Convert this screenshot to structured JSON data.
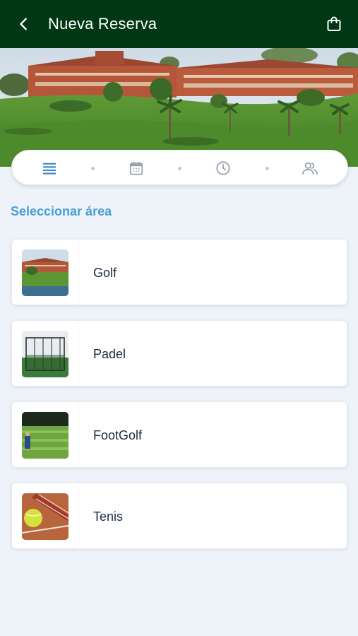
{
  "header": {
    "title": "Nueva Reserva",
    "back_icon": "chevron-left-icon",
    "cart_icon": "shopping-bag-icon",
    "background": "#003714"
  },
  "stepper": {
    "steps": [
      {
        "icon": "list-icon",
        "active": true
      },
      {
        "icon": "calendar-icon",
        "active": false
      },
      {
        "icon": "clock-icon",
        "active": false
      },
      {
        "icon": "users-icon",
        "active": false
      }
    ],
    "active_color": "#3d8bc9",
    "inactive_color": "#9aa3ae"
  },
  "section": {
    "title": "Seleccionar área"
  },
  "areas": [
    {
      "label": "Golf"
    },
    {
      "label": "Padel"
    },
    {
      "label": "FootGolf"
    },
    {
      "label": "Tenis"
    }
  ]
}
